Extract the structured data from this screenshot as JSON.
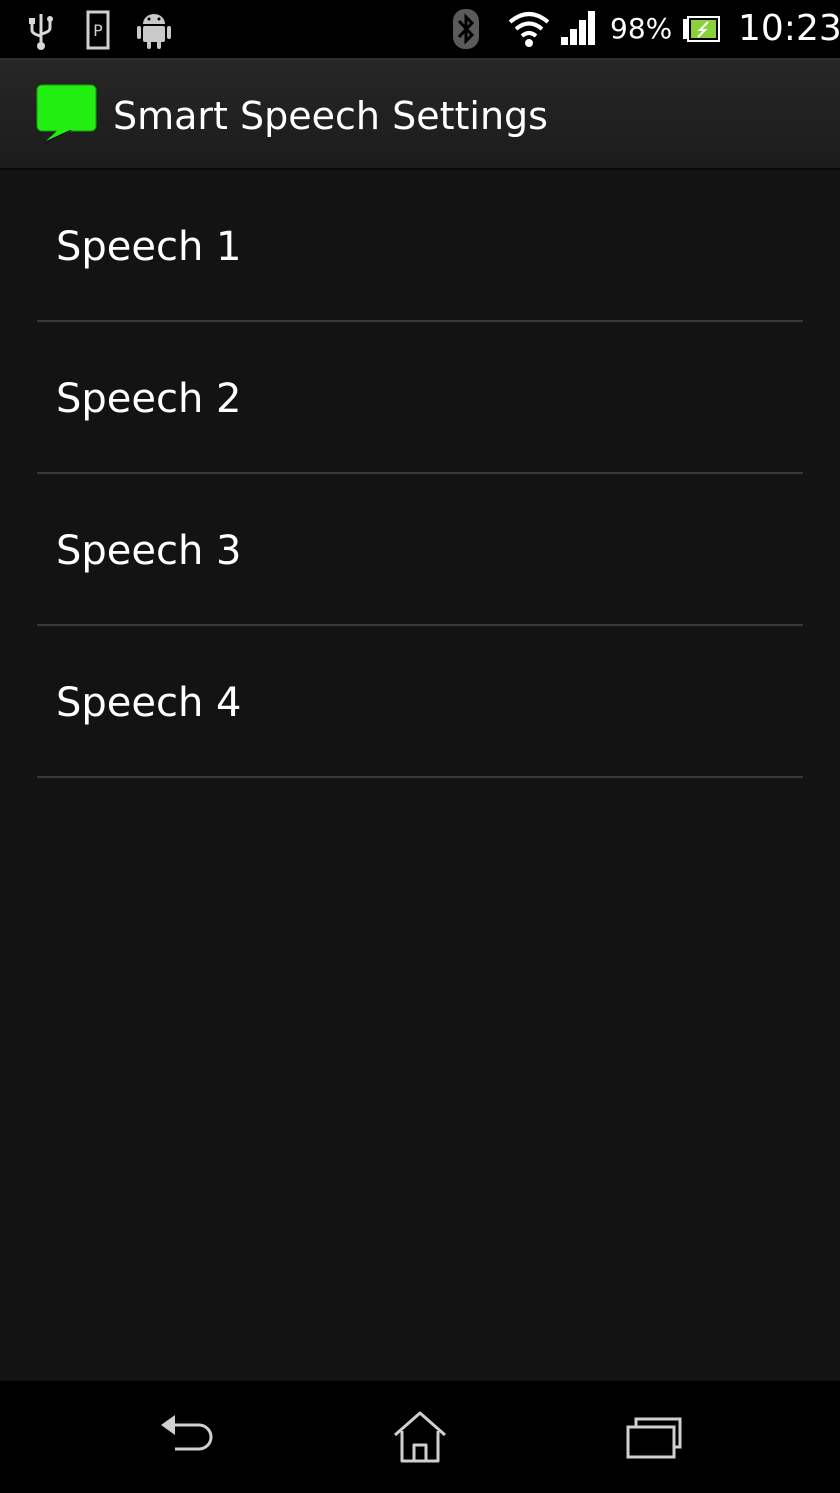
{
  "status_bar": {
    "icons": [
      "usb-icon",
      "parking-icon",
      "android-icon",
      "bluetooth-icon",
      "wifi-icon",
      "signal-icon",
      "battery-charging-icon"
    ],
    "battery_percent": "98%",
    "time": "10:23"
  },
  "action_bar": {
    "app_icon": "speech-bubble-icon",
    "app_icon_color": "#22ee11",
    "title": "Smart Speech Settings"
  },
  "list": {
    "items": [
      {
        "label": "Speech 1"
      },
      {
        "label": "Speech 2"
      },
      {
        "label": "Speech 3"
      },
      {
        "label": "Speech 4"
      }
    ]
  },
  "nav_bar": {
    "buttons": [
      "back-icon",
      "home-icon",
      "recent-apps-icon"
    ]
  }
}
